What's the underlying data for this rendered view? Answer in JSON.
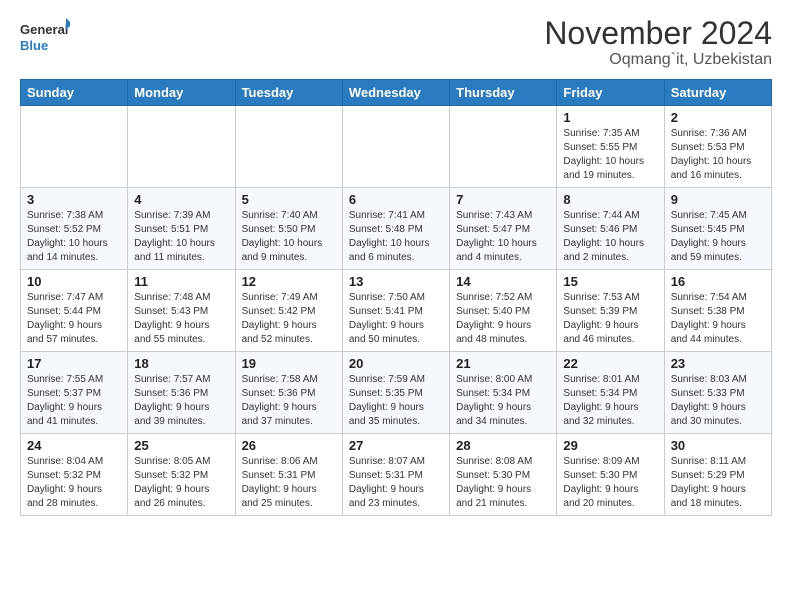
{
  "header": {
    "logo_line1": "General",
    "logo_line2": "Blue",
    "title": "November 2024",
    "subtitle": "Oqmang`it, Uzbekistan"
  },
  "weekdays": [
    "Sunday",
    "Monday",
    "Tuesday",
    "Wednesday",
    "Thursday",
    "Friday",
    "Saturday"
  ],
  "weeks": [
    [
      {
        "day": "",
        "info": ""
      },
      {
        "day": "",
        "info": ""
      },
      {
        "day": "",
        "info": ""
      },
      {
        "day": "",
        "info": ""
      },
      {
        "day": "",
        "info": ""
      },
      {
        "day": "1",
        "info": "Sunrise: 7:35 AM\nSunset: 5:55 PM\nDaylight: 10 hours\nand 19 minutes."
      },
      {
        "day": "2",
        "info": "Sunrise: 7:36 AM\nSunset: 5:53 PM\nDaylight: 10 hours\nand 16 minutes."
      }
    ],
    [
      {
        "day": "3",
        "info": "Sunrise: 7:38 AM\nSunset: 5:52 PM\nDaylight: 10 hours\nand 14 minutes."
      },
      {
        "day": "4",
        "info": "Sunrise: 7:39 AM\nSunset: 5:51 PM\nDaylight: 10 hours\nand 11 minutes."
      },
      {
        "day": "5",
        "info": "Sunrise: 7:40 AM\nSunset: 5:50 PM\nDaylight: 10 hours\nand 9 minutes."
      },
      {
        "day": "6",
        "info": "Sunrise: 7:41 AM\nSunset: 5:48 PM\nDaylight: 10 hours\nand 6 minutes."
      },
      {
        "day": "7",
        "info": "Sunrise: 7:43 AM\nSunset: 5:47 PM\nDaylight: 10 hours\nand 4 minutes."
      },
      {
        "day": "8",
        "info": "Sunrise: 7:44 AM\nSunset: 5:46 PM\nDaylight: 10 hours\nand 2 minutes."
      },
      {
        "day": "9",
        "info": "Sunrise: 7:45 AM\nSunset: 5:45 PM\nDaylight: 9 hours\nand 59 minutes."
      }
    ],
    [
      {
        "day": "10",
        "info": "Sunrise: 7:47 AM\nSunset: 5:44 PM\nDaylight: 9 hours\nand 57 minutes."
      },
      {
        "day": "11",
        "info": "Sunrise: 7:48 AM\nSunset: 5:43 PM\nDaylight: 9 hours\nand 55 minutes."
      },
      {
        "day": "12",
        "info": "Sunrise: 7:49 AM\nSunset: 5:42 PM\nDaylight: 9 hours\nand 52 minutes."
      },
      {
        "day": "13",
        "info": "Sunrise: 7:50 AM\nSunset: 5:41 PM\nDaylight: 9 hours\nand 50 minutes."
      },
      {
        "day": "14",
        "info": "Sunrise: 7:52 AM\nSunset: 5:40 PM\nDaylight: 9 hours\nand 48 minutes."
      },
      {
        "day": "15",
        "info": "Sunrise: 7:53 AM\nSunset: 5:39 PM\nDaylight: 9 hours\nand 46 minutes."
      },
      {
        "day": "16",
        "info": "Sunrise: 7:54 AM\nSunset: 5:38 PM\nDaylight: 9 hours\nand 44 minutes."
      }
    ],
    [
      {
        "day": "17",
        "info": "Sunrise: 7:55 AM\nSunset: 5:37 PM\nDaylight: 9 hours\nand 41 minutes."
      },
      {
        "day": "18",
        "info": "Sunrise: 7:57 AM\nSunset: 5:36 PM\nDaylight: 9 hours\nand 39 minutes."
      },
      {
        "day": "19",
        "info": "Sunrise: 7:58 AM\nSunset: 5:36 PM\nDaylight: 9 hours\nand 37 minutes."
      },
      {
        "day": "20",
        "info": "Sunrise: 7:59 AM\nSunset: 5:35 PM\nDaylight: 9 hours\nand 35 minutes."
      },
      {
        "day": "21",
        "info": "Sunrise: 8:00 AM\nSunset: 5:34 PM\nDaylight: 9 hours\nand 34 minutes."
      },
      {
        "day": "22",
        "info": "Sunrise: 8:01 AM\nSunset: 5:34 PM\nDaylight: 9 hours\nand 32 minutes."
      },
      {
        "day": "23",
        "info": "Sunrise: 8:03 AM\nSunset: 5:33 PM\nDaylight: 9 hours\nand 30 minutes."
      }
    ],
    [
      {
        "day": "24",
        "info": "Sunrise: 8:04 AM\nSunset: 5:32 PM\nDaylight: 9 hours\nand 28 minutes."
      },
      {
        "day": "25",
        "info": "Sunrise: 8:05 AM\nSunset: 5:32 PM\nDaylight: 9 hours\nand 26 minutes."
      },
      {
        "day": "26",
        "info": "Sunrise: 8:06 AM\nSunset: 5:31 PM\nDaylight: 9 hours\nand 25 minutes."
      },
      {
        "day": "27",
        "info": "Sunrise: 8:07 AM\nSunset: 5:31 PM\nDaylight: 9 hours\nand 23 minutes."
      },
      {
        "day": "28",
        "info": "Sunrise: 8:08 AM\nSunset: 5:30 PM\nDaylight: 9 hours\nand 21 minutes."
      },
      {
        "day": "29",
        "info": "Sunrise: 8:09 AM\nSunset: 5:30 PM\nDaylight: 9 hours\nand 20 minutes."
      },
      {
        "day": "30",
        "info": "Sunrise: 8:11 AM\nSunset: 5:29 PM\nDaylight: 9 hours\nand 18 minutes."
      }
    ]
  ]
}
